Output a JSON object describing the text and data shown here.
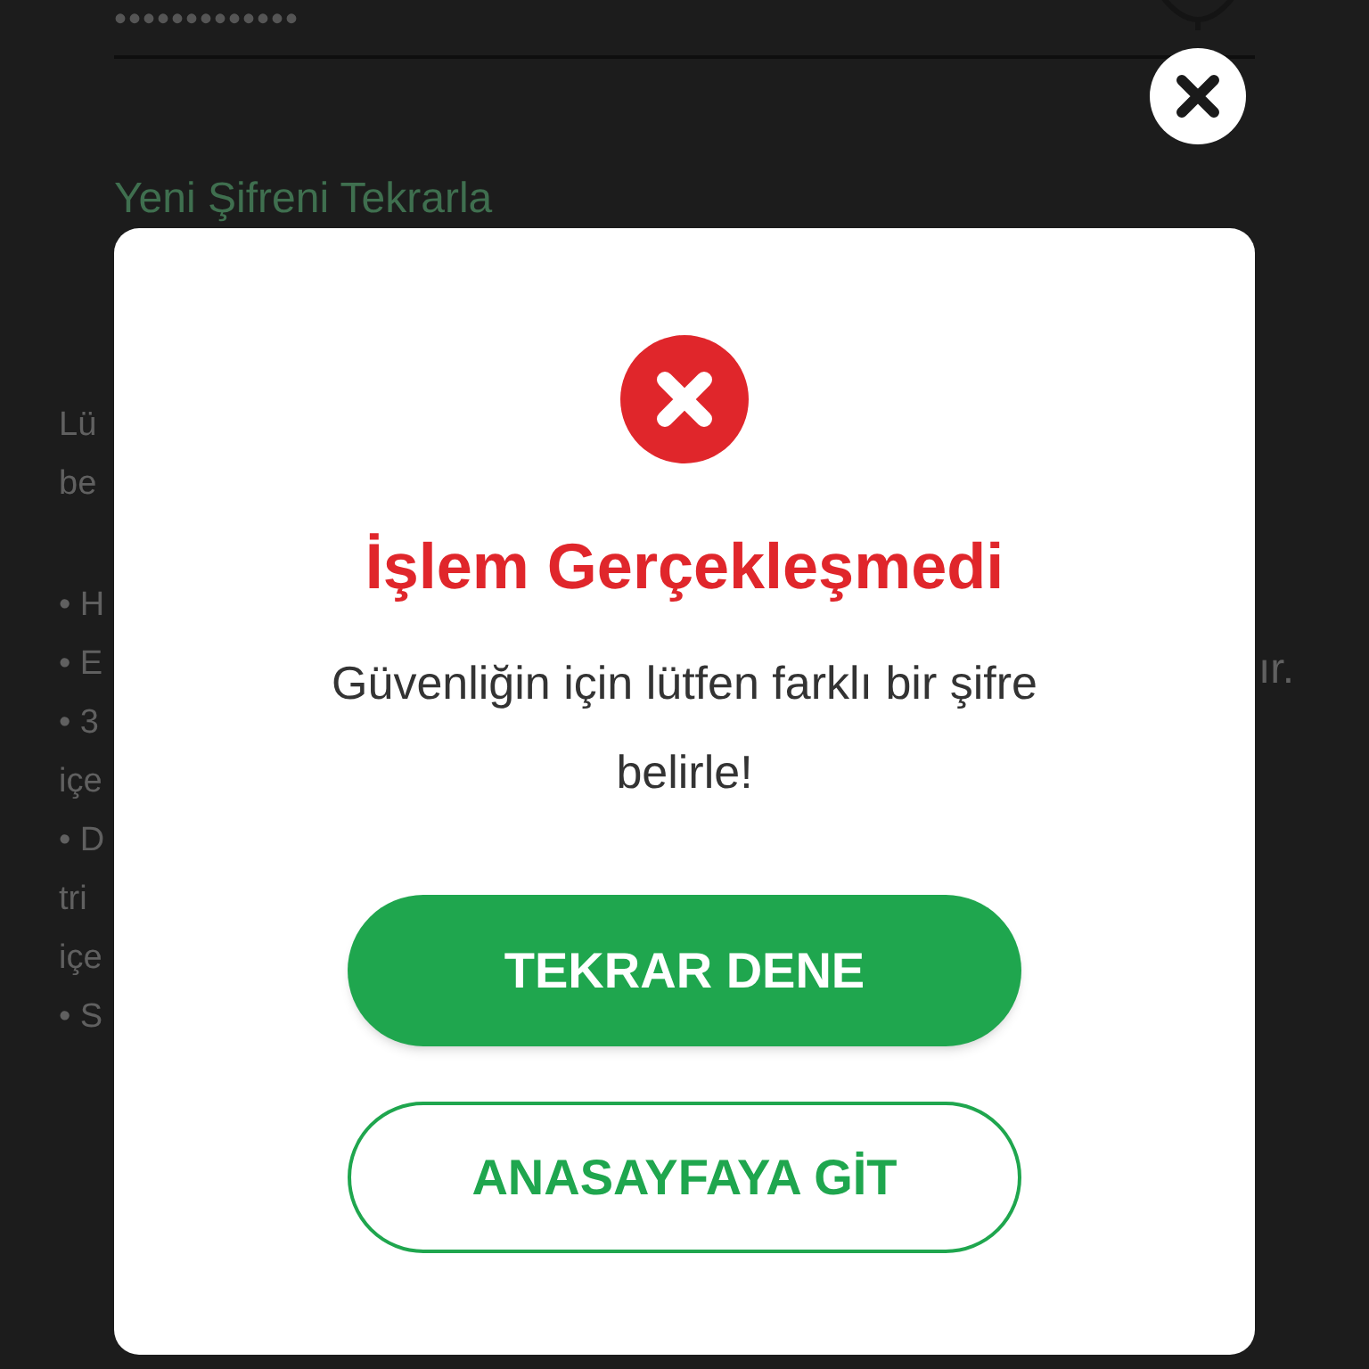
{
  "background": {
    "password_value": "•••••••••••••",
    "repeat_label": "Yeni Şifreni Tekrarla",
    "fragments": [
      "Lü",
      "be",
      "• H",
      "• E",
      "• 3",
      "içe",
      "• D",
      "tri",
      "içe",
      "• S"
    ],
    "right_fragment": "ır."
  },
  "dialog": {
    "title": "İşlem Gerçekleşmedi",
    "message": "Güvenliğin için lütfen farklı bir şifre belirle!",
    "buttons": [
      {
        "label": "TEKRAR DENE",
        "kind": "primary"
      },
      {
        "label": "ANASAYFAYA GİT",
        "kind": "outline"
      }
    ]
  }
}
